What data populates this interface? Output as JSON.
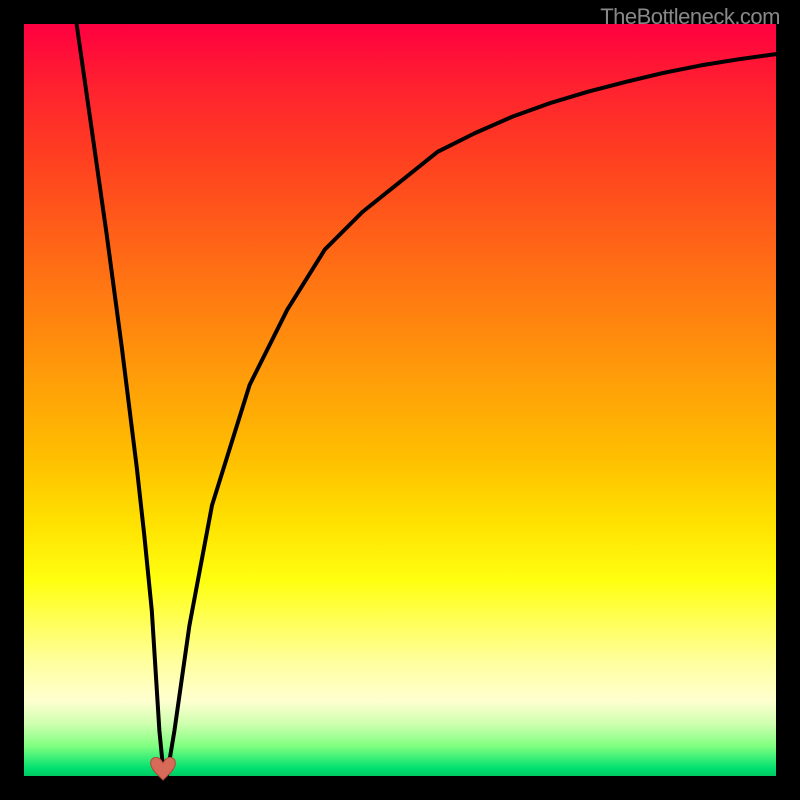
{
  "watermark": "TheBottleneck.com",
  "chart_data": {
    "type": "line",
    "title": "",
    "xlabel": "",
    "ylabel": "",
    "xlim": [
      0,
      100
    ],
    "ylim": [
      0,
      100
    ],
    "grid": false,
    "curve_samples": {
      "x": [
        7,
        9,
        11,
        13,
        15,
        16,
        17,
        17.5,
        18,
        18.5,
        19,
        20,
        22,
        25,
        30,
        35,
        40,
        45,
        50,
        55,
        60,
        65,
        70,
        75,
        80,
        85,
        90,
        95,
        100
      ],
      "y": [
        100,
        86,
        72,
        57,
        41,
        32,
        22,
        14,
        6,
        1,
        0,
        6,
        20,
        36,
        52,
        62,
        70,
        75,
        79,
        83,
        85.5,
        87.7,
        89.5,
        91,
        92.3,
        93.5,
        94.5,
        95.3,
        96
      ]
    },
    "marker": {
      "x": 18.5,
      "y": 1,
      "shape": "heart",
      "color": "#d86a5a"
    },
    "background_gradient": [
      "#ff0040",
      "#ffe000",
      "#00c860"
    ]
  }
}
